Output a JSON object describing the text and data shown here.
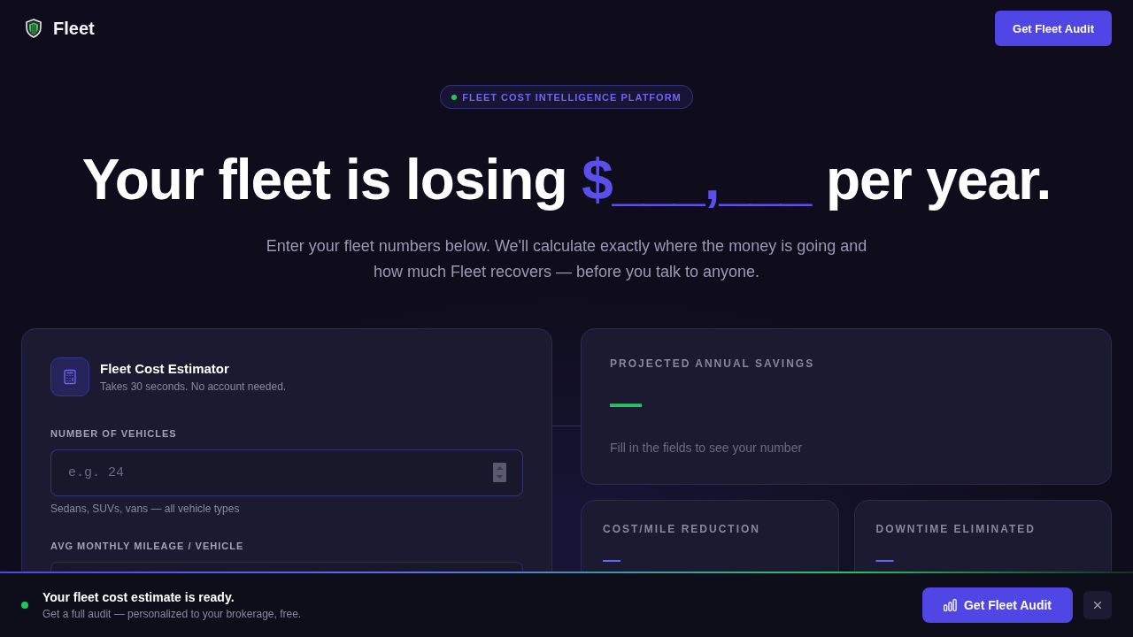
{
  "header": {
    "brand": "Fleet",
    "cta": "Get Fleet Audit"
  },
  "hero": {
    "badge": "FLEET COST INTELLIGENCE PLATFORM",
    "headline": {
      "before": "Your fleet is losing",
      "highlight": "$___,___",
      "after": "per year."
    },
    "subtitle": "Enter your fleet numbers below. We'll calculate exactly where the money is going and how much Fleet recovers — before you talk to anyone."
  },
  "estimator": {
    "title": "Fleet Cost Estimator",
    "subtitle": "Takes 30 seconds. No account needed.",
    "fields": [
      {
        "label": "NUMBER OF VEHICLES",
        "placeholder": "e.g. 24",
        "hint": "Sedans, SUVs, vans — all vehicle types",
        "hovered": true
      },
      {
        "label": "AVG MONTHLY MILEAGE / VEHICLE",
        "hovered": false
      }
    ]
  },
  "results": {
    "savings": {
      "label": "PROJECTED ANNUAL SAVINGS",
      "value": "—",
      "note": "Fill in the fields to see your number"
    },
    "metrics": [
      {
        "label": "COST/MILE REDUCTION",
        "value": "—"
      },
      {
        "label": "DOWNTIME ELIMINATED",
        "value": "—"
      }
    ]
  },
  "sticky_bar": {
    "title": "Your fleet cost estimate is ready.",
    "subtitle": "Get a full audit — personalized to your brokerage, free.",
    "cta": "Get Fleet Audit"
  }
}
